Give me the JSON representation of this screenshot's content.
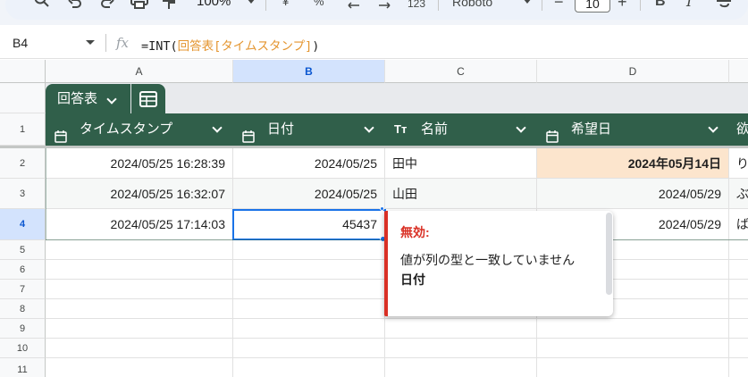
{
  "toolbar": {
    "zoom": "100%",
    "percent": "%",
    "more_formats": "123",
    "font": "Roboto",
    "font_size": "10",
    "minus": "−",
    "plus": "+",
    "bold": "B",
    "italic": "I",
    "currency": "¥"
  },
  "formula_bar": {
    "cell_ref": "B4",
    "fx": "fx",
    "formula_prefix": "=INT(",
    "formula_ref": "回答表[タイムスタンプ]",
    "formula_suffix": ")"
  },
  "columns": [
    "A",
    "B",
    "C",
    "D"
  ],
  "rows": [
    "1",
    "2",
    "3",
    "4",
    "5",
    "6",
    "7",
    "8",
    "9",
    "10",
    "11"
  ],
  "table": {
    "name": "回答表",
    "headers": [
      {
        "label": "タイムスタンプ",
        "icon": "calendar-icon"
      },
      {
        "label": "日付",
        "icon": "calendar-icon"
      },
      {
        "label": "名前",
        "icon": "text-type-icon",
        "icon_text": "Tт"
      },
      {
        "label": "希望日",
        "icon": "calendar-icon"
      },
      {
        "label": "欲",
        "icon": ""
      }
    ],
    "rows": [
      [
        "2024/05/25 16:28:39",
        "2024/05/25",
        "田中",
        "2024年05月14日",
        "り"
      ],
      [
        "2024/05/25 16:32:07",
        "2024/05/25",
        "山田",
        "2024/05/29",
        "ぶ"
      ],
      [
        "2024/05/25 17:14:03",
        "45437",
        "",
        "2024/05/29",
        "ば"
      ]
    ]
  },
  "tooltip": {
    "title": "無効:",
    "message": "値が列の型と一致していません",
    "column": "日付"
  },
  "colors": {
    "table_header": "#305f4a",
    "highlight": "#fce5cd",
    "selection": "#1a73e8",
    "error": "#d93025"
  }
}
